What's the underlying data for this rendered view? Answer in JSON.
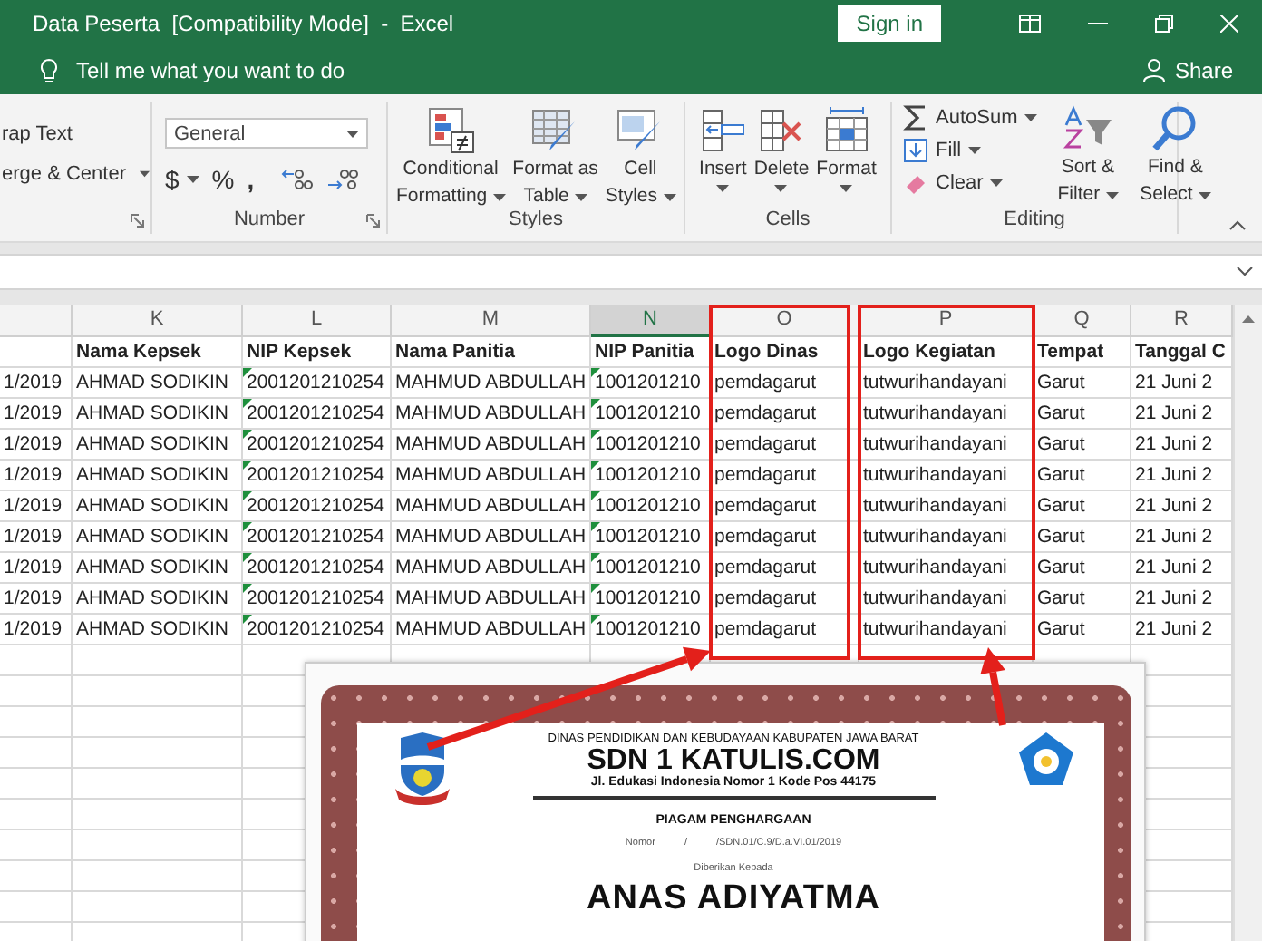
{
  "window": {
    "title": "Data Peserta  [Compatibility Mode]  -  Excel",
    "sign_in": "Sign in"
  },
  "tell_me": {
    "placeholder": "Tell me what you want to do"
  },
  "share": "Share",
  "ribbon": {
    "alignment": {
      "items": [
        "rap Text",
        "erge & Center"
      ]
    },
    "number": {
      "format": "General",
      "symbols": [
        "$",
        "%",
        ","
      ],
      "label": "Number"
    },
    "styles": {
      "buttons": [
        {
          "lines": [
            "Conditional",
            "Formatting"
          ]
        },
        {
          "lines": [
            "Format as",
            "Table"
          ]
        },
        {
          "lines": [
            "Cell",
            "Styles"
          ]
        }
      ],
      "label": "Styles"
    },
    "cells": {
      "buttons": [
        {
          "lines": [
            "Insert"
          ]
        },
        {
          "lines": [
            "Delete"
          ]
        },
        {
          "lines": [
            "Format"
          ]
        }
      ],
      "label": "Cells"
    },
    "editing": {
      "small_buttons": [
        "AutoSum",
        "Fill",
        "Clear"
      ],
      "buttons": [
        {
          "lines": [
            "Sort &",
            "Filter"
          ]
        },
        {
          "lines": [
            "Find &",
            "Select"
          ]
        }
      ],
      "label": "Editing"
    }
  },
  "sheet": {
    "columns": [
      {
        "selected": false,
        "flagged": false
      },
      {
        "letter": "K",
        "header": "Nama Kepsek",
        "selected": false,
        "flagged": false
      },
      {
        "letter": "L",
        "header": "NIP Kepsek",
        "selected": false,
        "flagged": true
      },
      {
        "letter": "M",
        "header": "Nama Panitia",
        "selected": false,
        "flagged": false
      },
      {
        "letter": "N",
        "header": "NIP Panitia",
        "selected": true,
        "flagged": true
      },
      {
        "letter": "O",
        "header": "Logo Dinas",
        "selected": false,
        "flagged": false
      },
      {
        "letter": "P",
        "header": "Logo Kegiatan",
        "selected": false,
        "flagged": false
      },
      {
        "letter": "Q",
        "header": "Tempat",
        "selected": false,
        "flagged": false
      },
      {
        "letter": "R",
        "header": "Tanggal C",
        "selected": false,
        "flagged": false
      }
    ],
    "rows": [
      [
        "1/2019",
        "AHMAD SODIKIN",
        "2001201210254",
        "MAHMUD ABDULLAH",
        "1001201210",
        "pemdagarut",
        "tutwurihandayani",
        "Garut",
        "21 Juni 2"
      ],
      [
        "1/2019",
        "AHMAD SODIKIN",
        "2001201210254",
        "MAHMUD ABDULLAH",
        "1001201210",
        "pemdagarut",
        "tutwurihandayani",
        "Garut",
        "21 Juni 2"
      ],
      [
        "1/2019",
        "AHMAD SODIKIN",
        "2001201210254",
        "MAHMUD ABDULLAH",
        "1001201210",
        "pemdagarut",
        "tutwurihandayani",
        "Garut",
        "21 Juni 2"
      ],
      [
        "1/2019",
        "AHMAD SODIKIN",
        "2001201210254",
        "MAHMUD ABDULLAH",
        "1001201210",
        "pemdagarut",
        "tutwurihandayani",
        "Garut",
        "21 Juni 2"
      ],
      [
        "1/2019",
        "AHMAD SODIKIN",
        "2001201210254",
        "MAHMUD ABDULLAH",
        "1001201210",
        "pemdagarut",
        "tutwurihandayani",
        "Garut",
        "21 Juni 2"
      ],
      [
        "1/2019",
        "AHMAD SODIKIN",
        "2001201210254",
        "MAHMUD ABDULLAH",
        "1001201210",
        "pemdagarut",
        "tutwurihandayani",
        "Garut",
        "21 Juni 2"
      ],
      [
        "1/2019",
        "AHMAD SODIKIN",
        "2001201210254",
        "MAHMUD ABDULLAH",
        "1001201210",
        "pemdagarut",
        "tutwurihandayani",
        "Garut",
        "21 Juni 2"
      ],
      [
        "1/2019",
        "AHMAD SODIKIN",
        "2001201210254",
        "MAHMUD ABDULLAH",
        "1001201210",
        "pemdagarut",
        "tutwurihandayani",
        "Garut",
        "21 Juni 2"
      ],
      [
        "1/2019",
        "AHMAD SODIKIN",
        "2001201210254",
        "MAHMUD ABDULLAH",
        "1001201210",
        "pemdagarut",
        "tutwurihandayani",
        "Garut",
        "21 Juni 2"
      ]
    ]
  },
  "certificate": {
    "agency": "DINAS PENDIDIKAN DAN KEBUDAYAAN KABUPATEN JAWA BARAT",
    "school": "SDN 1 KATULIS.COM",
    "address": "Jl. Edukasi Indonesia Nomor 1 Kode Pos 44175",
    "title": "PIAGAM PENGHARGAAN",
    "number_label": "Nomor",
    "number_sep": "/",
    "number_value": "/SDN.01/C.9/D.a.VI.01/2019",
    "given_to": "Diberikan Kepada",
    "recipient": "ANAS ADIYATMA"
  }
}
